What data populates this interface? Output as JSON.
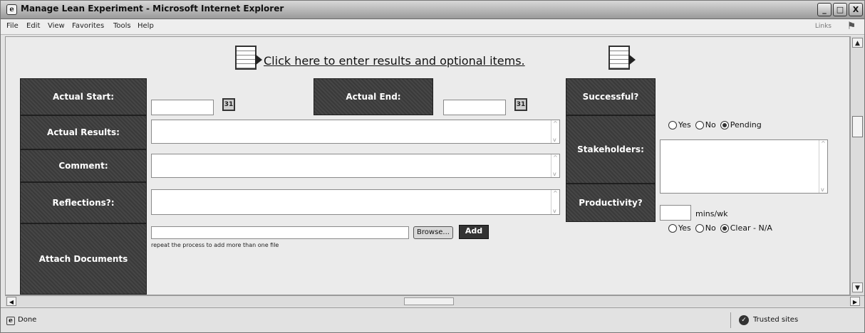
{
  "window": {
    "title": "Manage Lean Experiment - Microsoft Internet Explorer",
    "app_icon": "e",
    "minimize": "_",
    "maximize": "□",
    "close": "X"
  },
  "menu": {
    "items": [
      "File",
      "Edit",
      "View",
      "Favorites",
      "Tools",
      "Help"
    ],
    "links_label": "Links"
  },
  "header": {
    "link_text": "Click here to enter results and optional items."
  },
  "form": {
    "actual_start": {
      "label": "Actual Start:",
      "value": ""
    },
    "actual_end": {
      "label": "Actual End:",
      "value": ""
    },
    "calendar_icon_glyph": "31",
    "successful": {
      "label": "Successful?",
      "options": [
        "Yes",
        "No",
        "Pending"
      ],
      "selected": "Pending"
    },
    "actual_results": {
      "label": "Actual Results:",
      "value": ""
    },
    "stakeholders": {
      "label": "Stakeholders:",
      "value": ""
    },
    "comment": {
      "label": "Comment:",
      "value": ""
    },
    "reflections": {
      "label": "Reflections?:",
      "value": ""
    },
    "productivity": {
      "label": "Productivity?",
      "options": [
        "Yes",
        "No",
        "Clear - N/A"
      ],
      "selected": "Clear - N/A",
      "minutes_value": "",
      "minutes_unit": "mins/wk"
    },
    "attach_documents": {
      "label": "Attach Documents",
      "file_value": "",
      "browse_label": "Browse...",
      "add_label": "Add",
      "hint": "repeat the process to add more than one file"
    }
  },
  "status": {
    "text": "Done",
    "zone": "Trusted sites"
  }
}
